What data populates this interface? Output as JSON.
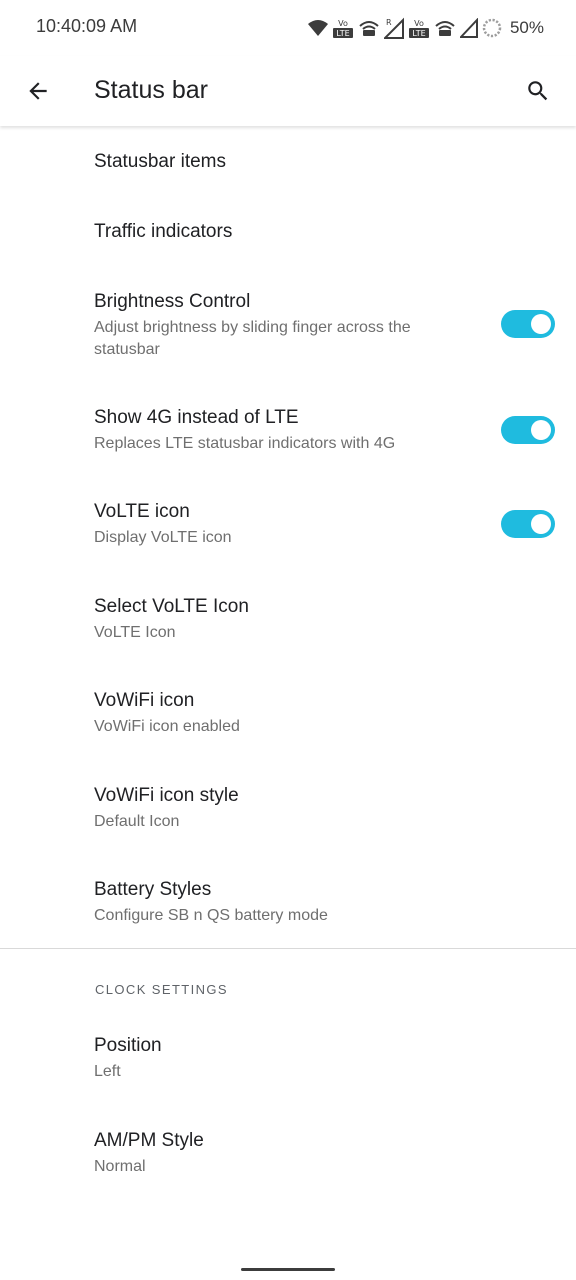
{
  "status_bar": {
    "time": "10:40:09 AM",
    "battery_percent": "50%",
    "icons": [
      "wifi-icon",
      "volte-icon",
      "vowifi-icon",
      "roaming-signal-icon",
      "volte-icon",
      "vowifi-icon",
      "signal-icon",
      "battery-ring-icon"
    ]
  },
  "toolbar": {
    "title": "Status bar",
    "back_icon": "arrow-back-icon",
    "search_icon": "search-icon"
  },
  "preferences": [
    {
      "title": "Statusbar items"
    },
    {
      "title": "Traffic indicators"
    },
    {
      "title": "Brightness Control",
      "summary": "Adjust brightness by sliding finger across the statusbar",
      "toggle": true
    },
    {
      "title": "Show 4G instead of LTE",
      "summary": "Replaces LTE statusbar indicators with 4G",
      "toggle": true
    },
    {
      "title": "VoLTE icon",
      "summary": "Display VoLTE icon",
      "toggle": true
    },
    {
      "title": "Select VoLTE Icon",
      "summary": "VoLTE Icon"
    },
    {
      "title": "VoWiFi icon",
      "summary": "VoWiFi icon enabled"
    },
    {
      "title": "VoWiFi icon style",
      "summary": "Default Icon"
    },
    {
      "title": "Battery Styles",
      "summary": "Configure SB n QS battery mode"
    }
  ],
  "clock_section": {
    "header": "CLOCK SETTINGS",
    "items": [
      {
        "title": "Position",
        "summary": "Left"
      },
      {
        "title": "AM/PM Style",
        "summary": "Normal"
      }
    ]
  },
  "colors": {
    "accent": "#1fbbdf",
    "text_primary": "#202124",
    "text_secondary": "#6f6f6f"
  }
}
